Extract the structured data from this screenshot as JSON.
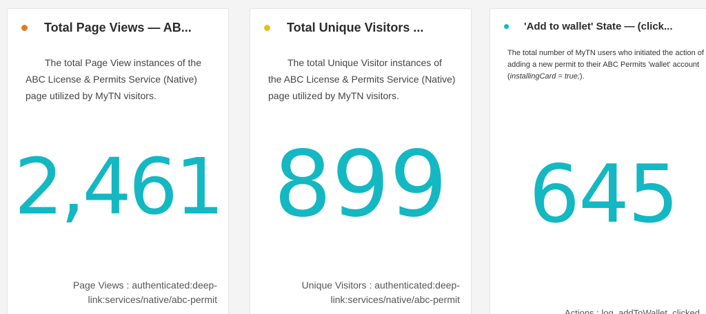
{
  "cards": [
    {
      "dot_color": "#e07b24",
      "title": "Total Page Views — AB...",
      "description": "The total Page View instances of the ABC License & Permits Service (Native) page utilized by MyTN visitors.",
      "value": "2,461",
      "footer_line1": "Page Views : authenticated:deep-",
      "footer_line2": "link:services/native/abc-permit"
    },
    {
      "dot_color": "#e8bf1a",
      "title": "Total Unique Visitors ...",
      "description": "The total Unique Visitor instances of the ABC License & Permits Service (Native) page utilized by MyTN visitors.",
      "value": "899",
      "footer_line1": "Unique Visitors : authenticated:deep-",
      "footer_line2": "link:services/native/abc-permit"
    },
    {
      "dot_color": "#13b8c2",
      "title": "'Add to wallet' State — (click...",
      "description_main": "The total number of MyTN users who initiated the action of adding a new permit to their ABC Permits 'wallet' account (",
      "description_code": "installingCard = true;",
      "description_end": ").",
      "value": "645",
      "footer": "Actions : log_addToWallet_clicked"
    }
  ],
  "accent_color": "#13b8c2"
}
